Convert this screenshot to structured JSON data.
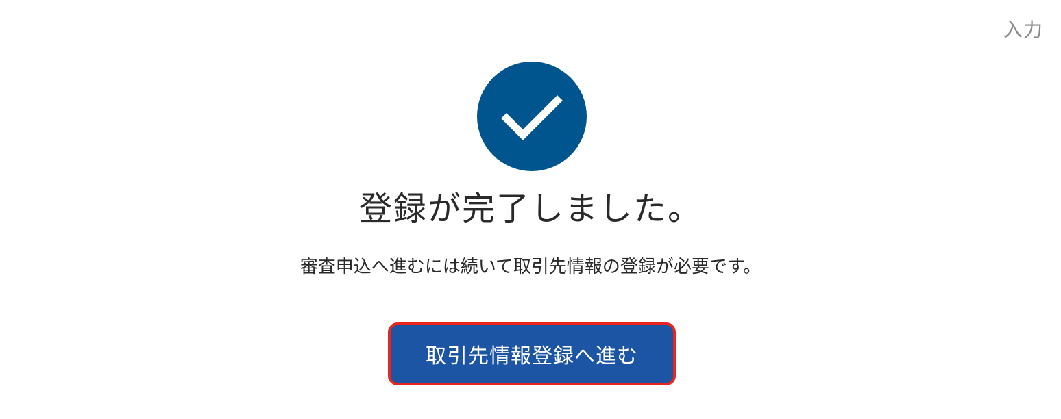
{
  "header": {
    "step_label": "入力"
  },
  "status": {
    "icon": "check-circle-icon",
    "icon_color": "#00558f",
    "title": "登録が完了しました。",
    "message": "審査申込へ進むには続いて取引先情報の登録が必要です。"
  },
  "actions": {
    "proceed_label": "取引先情報登録へ進む",
    "button_color": "#1c55a4",
    "highlight_color": "#e8261f"
  }
}
